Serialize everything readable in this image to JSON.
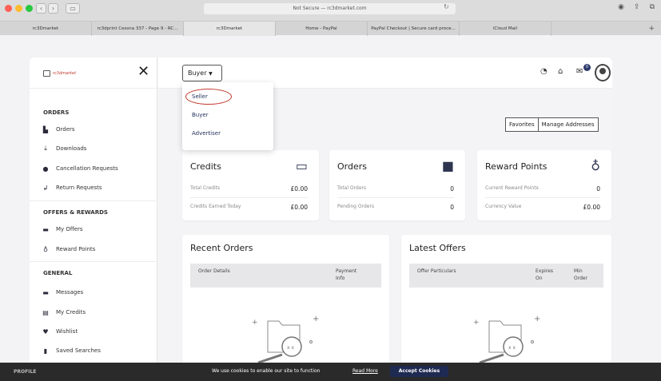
{
  "browser": {
    "url": "Not Secure — rc3dmarket.com",
    "tabs": [
      "rc3Dmarket",
      "rc3dprint Cessna 337 - Page 9 - RC...",
      "rc3Dmarket",
      "Home - PayPal",
      "PayPal Checkout | Secure card proce...",
      "iCloud Mail"
    ],
    "active_tab": 2
  },
  "sidebar": {
    "logo_text": "rc3dmarket",
    "sections": [
      {
        "title": "ORDERS",
        "items": [
          {
            "label": "Orders",
            "icon": "orders-icon"
          },
          {
            "label": "Downloads",
            "icon": "download-icon"
          },
          {
            "label": "Cancellation Requests",
            "icon": "cancel-icon"
          },
          {
            "label": "Return Requests",
            "icon": "return-icon"
          }
        ]
      },
      {
        "title": "OFFERS & REWARDS",
        "items": [
          {
            "label": "My Offers",
            "icon": "offers-icon"
          },
          {
            "label": "Reward Points",
            "icon": "money-bag-icon"
          }
        ]
      },
      {
        "title": "GENERAL",
        "items": [
          {
            "label": "Messages",
            "icon": "messages-icon"
          },
          {
            "label": "My Credits",
            "icon": "credits-icon"
          },
          {
            "label": "Wishlist",
            "icon": "heart-icon"
          },
          {
            "label": "Saved Searches",
            "icon": "bookmark-icon"
          }
        ]
      }
    ],
    "profile_label": "PROFILE"
  },
  "topbar": {
    "role_button": "Buyer",
    "messages_badge": "0"
  },
  "role_dropdown": {
    "items": [
      "Seller",
      "Buyer",
      "Advertiser"
    ],
    "highlighted": "Seller"
  },
  "actions": {
    "favorites": "Favorites",
    "manage_addresses": "Manage Addresses"
  },
  "cards": {
    "credits": {
      "title": "Credits",
      "rows": [
        {
          "label": "Total Credits",
          "value": "£0.00"
        },
        {
          "label": "Credits Earned Today",
          "value": "£0.00"
        }
      ]
    },
    "orders": {
      "title": "Orders",
      "rows": [
        {
          "label": "Total Orders",
          "value": "0"
        },
        {
          "label": "Pending Orders",
          "value": "0"
        }
      ]
    },
    "rewards": {
      "title": "Reward Points",
      "rows": [
        {
          "label": "Current Reward Points",
          "value": "0"
        },
        {
          "label": "Currency Value",
          "value": "£0.00"
        }
      ]
    }
  },
  "recent_orders": {
    "title": "Recent Orders",
    "col_details": "Order Details",
    "col_payment_1": "Payment",
    "col_payment_2": "Info"
  },
  "latest_offers": {
    "title": "Latest Offers",
    "col_particulars": "Offer Particulars",
    "col_expires_1": "Expires",
    "col_expires_2": "On",
    "col_min_1": "Min",
    "col_min_2": "Order"
  },
  "cookie_banner": {
    "text": "We use cookies to enable our site to function",
    "link": "Read More",
    "button": "Accept Cookies"
  },
  "colors": {
    "accent_navy": "#1f2a52",
    "highlight_red": "#c0392b"
  }
}
